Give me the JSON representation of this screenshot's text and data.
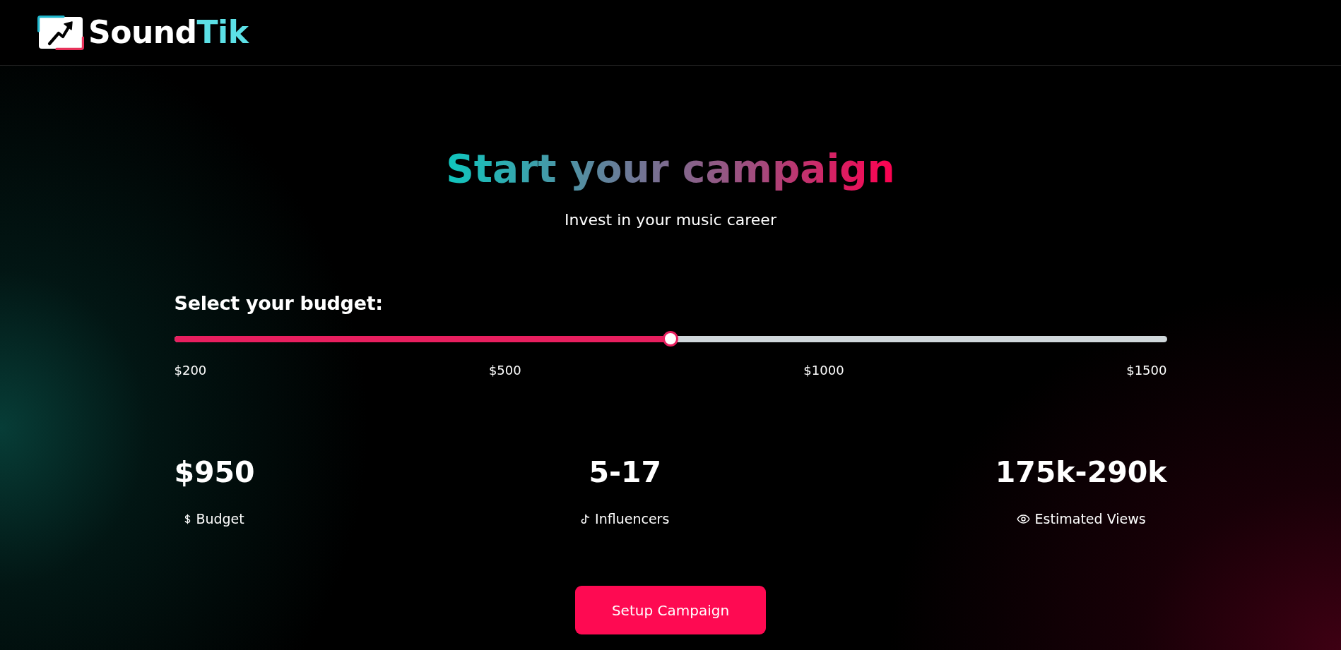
{
  "header": {
    "brand": {
      "name": "Sound",
      "accent": "Tik"
    }
  },
  "hero": {
    "title": "Start your campaign",
    "subtitle": "Invest in your music career"
  },
  "budget": {
    "label": "Select your budget:",
    "slider": {
      "level": 0.5
    },
    "ticks": [
      "$200",
      "$500",
      "$1000",
      "$1500"
    ]
  },
  "stats": [
    {
      "kind": "budget",
      "value": "$950",
      "label": "Budget"
    },
    {
      "kind": "influencers",
      "value": "5-17",
      "label": "Influencers"
    },
    {
      "kind": "views",
      "value": "175k-290k",
      "label": "Estimated Views"
    }
  ],
  "button": {
    "label": "Setup Campaign"
  }
}
